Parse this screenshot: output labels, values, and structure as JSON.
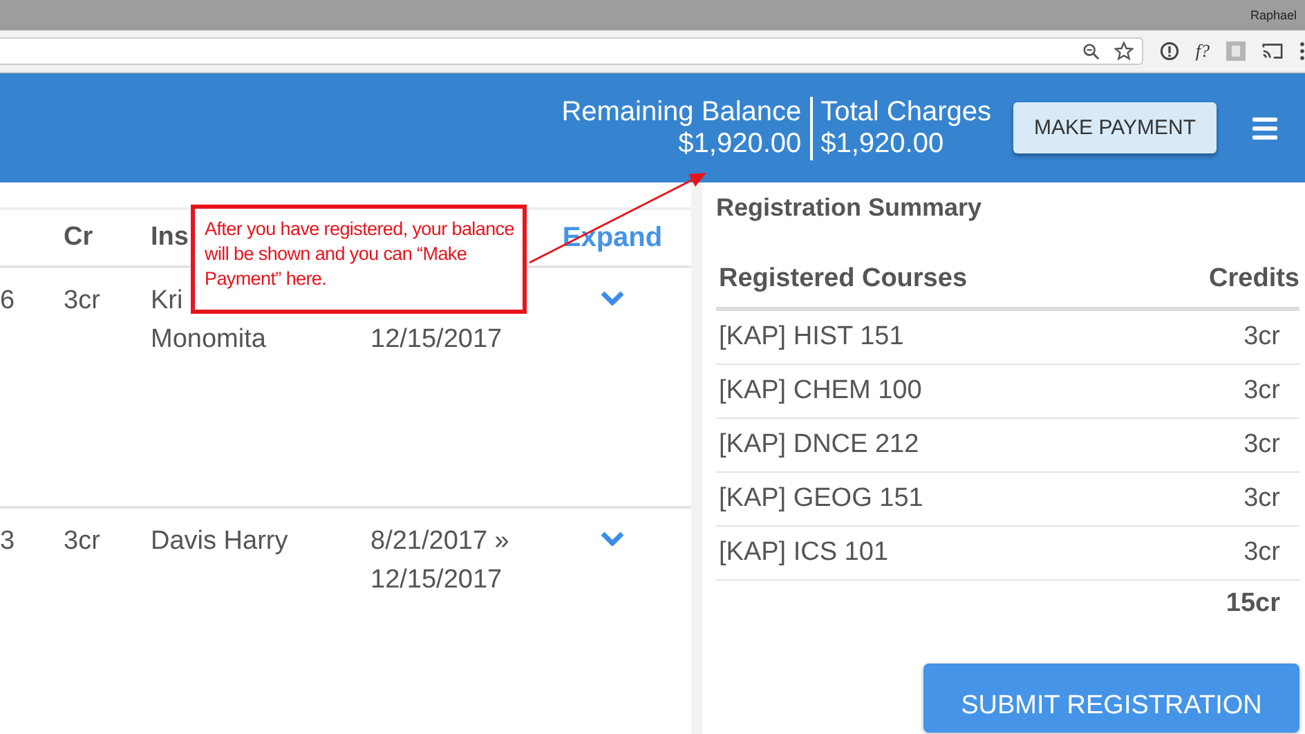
{
  "browser": {
    "profile": "Raphael",
    "extension_label": "f?"
  },
  "header": {
    "balance_label": "Remaining Balance",
    "balance": "$1,920.00",
    "charges_label": "Total Charges",
    "charges": "$1,920.00",
    "pay_button": "MAKE PAYMENT"
  },
  "courses": {
    "columns": [
      "Cr",
      "Ins"
    ],
    "expand_label": "Expand",
    "rows": [
      {
        "code": "6",
        "credits": "3cr",
        "instructor": [
          "Kri",
          "Monomita"
        ],
        "date_end": "12/15/2017"
      },
      {
        "code": "3",
        "credits": "3cr",
        "instructor": [
          "Davis Harry"
        ],
        "date_start": "8/21/2017 »",
        "date_end": "12/15/2017"
      }
    ]
  },
  "callout": {
    "text": "After you have registered, your balance will be shown and you can “Make Payment” here."
  },
  "summary": {
    "title": "Registration Summary",
    "columns": [
      "Registered Courses",
      "Credits"
    ],
    "rows": [
      {
        "course": "[KAP] HIST 151",
        "credits": "3cr"
      },
      {
        "course": "[KAP] CHEM 100",
        "credits": "3cr"
      },
      {
        "course": "[KAP] DNCE 212",
        "credits": "3cr"
      },
      {
        "course": "[KAP] GEOG 151",
        "credits": "3cr"
      },
      {
        "course": "[KAP] ICS 101",
        "credits": "3cr"
      }
    ],
    "total": "15cr",
    "submit_button": "SUBMIT REGISTRATION"
  }
}
